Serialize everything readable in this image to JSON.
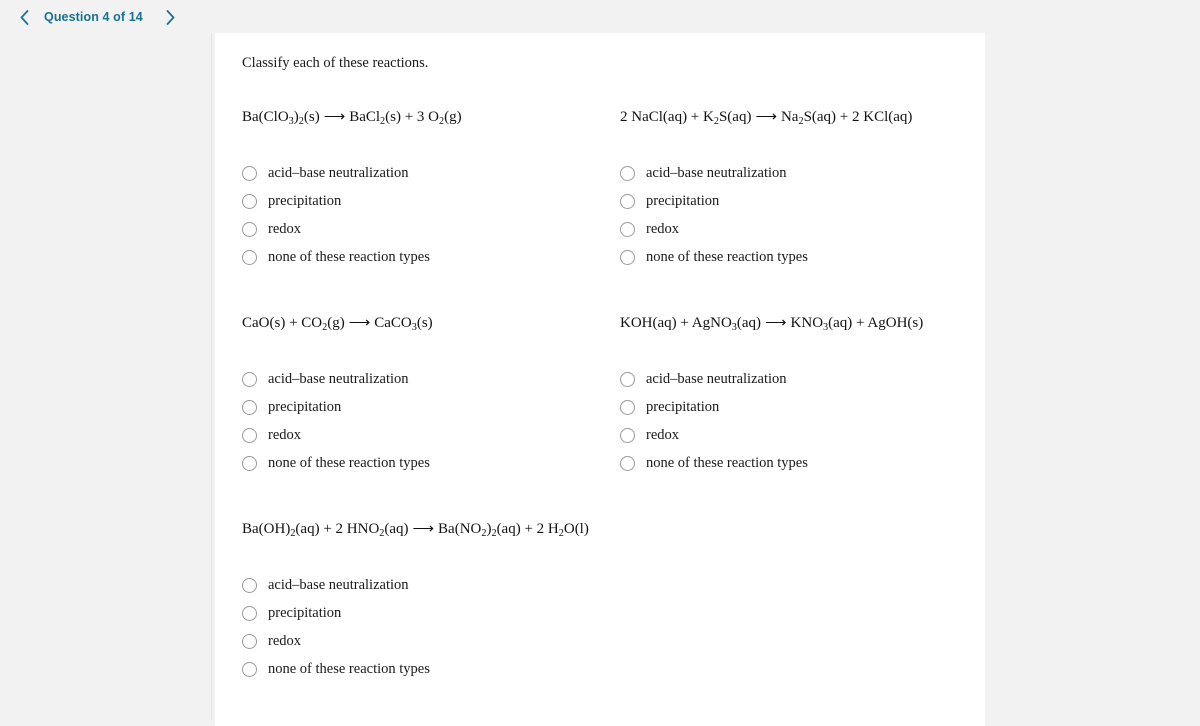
{
  "header": {
    "prev_icon": "chevron-left-icon",
    "next_icon": "chevron-right-icon",
    "counter": "Question 4 of 14"
  },
  "colors": {
    "accent_teal": "#19738f",
    "page_background": "#f2f2f2",
    "card_background": "#ffffff",
    "radio_border": "#9a9a9a",
    "text": "#1a1a1a"
  },
  "main": {
    "prompt": "Classify each of these reactions.",
    "options": [
      "acid–base neutralization",
      "precipitation",
      "redox",
      "none of these reaction types"
    ],
    "questions": [
      {
        "id": "q1",
        "equation_text": "Ba(ClO3)2(s) ⟶ BaCl2(s) + 3 O2(g)",
        "reactants": [
          {
            "formula": "Ba(ClO",
            "sub": "3",
            "after": ")",
            "sub2": "2",
            "tail": "(s)"
          }
        ],
        "selected": null
      },
      {
        "id": "q2",
        "equation_text": "2 NaCl(aq) + K2S(aq) ⟶ Na2S(aq) + 2 KCl(aq)",
        "selected": null
      },
      {
        "id": "q3",
        "equation_text": "CaO(s) + CO2(g) ⟶ CaCO3(s)",
        "selected": null
      },
      {
        "id": "q4",
        "equation_text": "KOH(aq) + AgNO3(aq) ⟶ KNO3(aq) + AgOH(s)",
        "selected": null
      },
      {
        "id": "q5",
        "equation_text": "Ba(OH)2(aq) + 2 HNO2(aq) ⟶ Ba(NO2)2(aq) + 2 H2O(l)",
        "selected": null
      }
    ]
  }
}
